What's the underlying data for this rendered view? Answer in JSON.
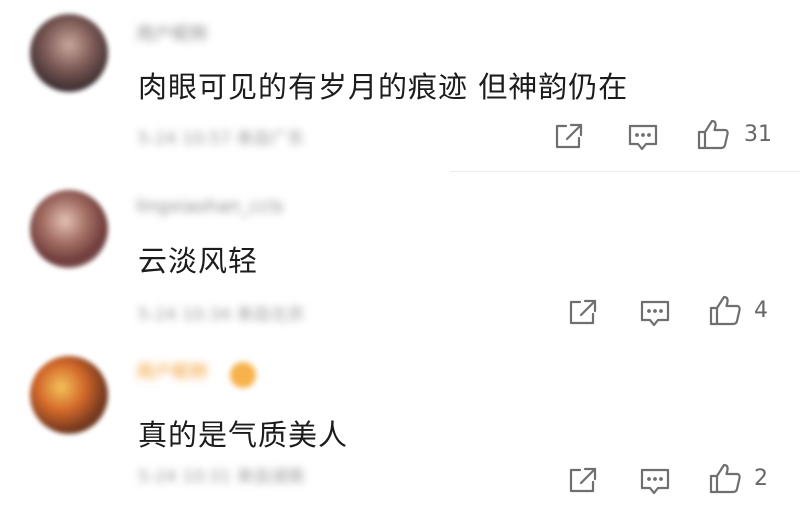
{
  "comments": [
    {
      "username": "用户昵称",
      "content": "肉眼可见的有岁月的痕迹 但神韵仍在",
      "meta": "5-24 10:57 来自广东",
      "likes": "31"
    },
    {
      "username": "lingxiaohan_ccls",
      "content": "云淡风轻",
      "meta": "5-24 10:34 来自北京",
      "likes": "4"
    },
    {
      "username": "用户昵称",
      "content": "真的是气质美人",
      "meta": "5-24 10:31 来自湖南",
      "likes": "2"
    }
  ],
  "icons": {
    "share": "share-icon",
    "reply": "reply-icon",
    "like": "thumbs-up-icon"
  },
  "colors": {
    "text": "#1c1c1c",
    "icon": "#6f6f6f",
    "vip_name": "#f39a2e"
  }
}
